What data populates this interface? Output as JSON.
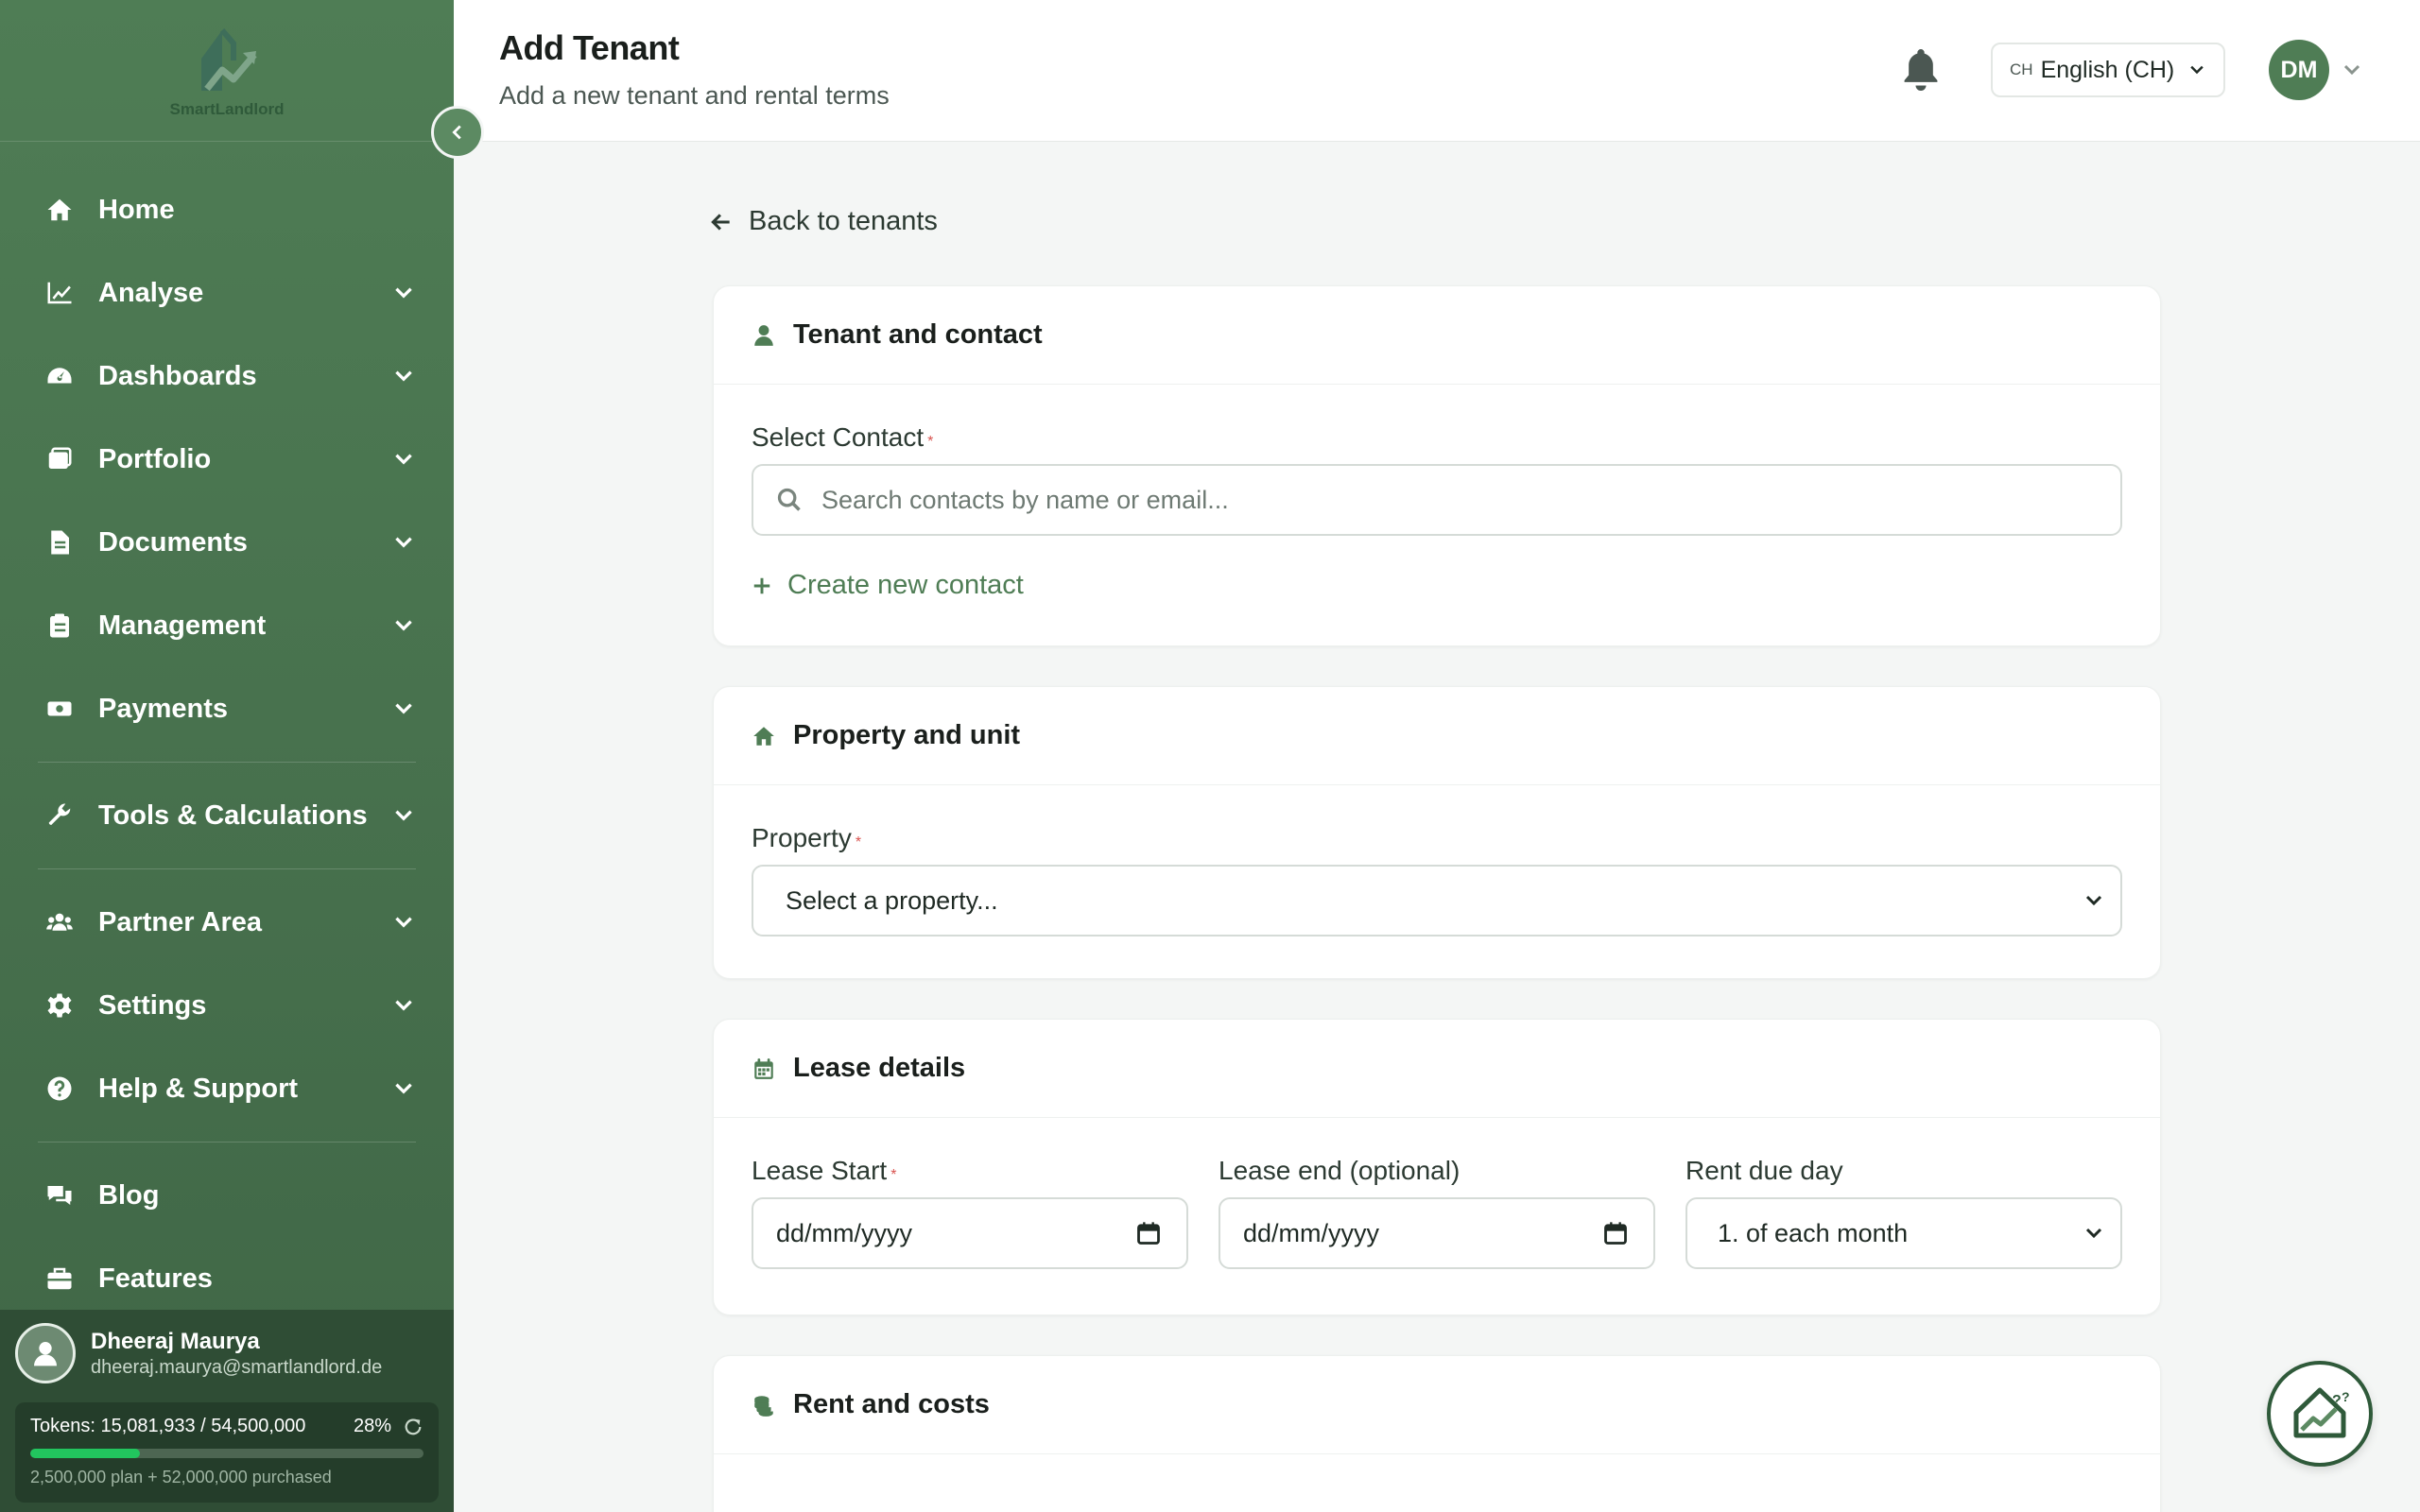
{
  "sidebar": {
    "logo_text": "SmartLandlord",
    "items": [
      {
        "label": "Home",
        "icon": "home-icon",
        "has_children": false
      },
      {
        "label": "Analyse",
        "icon": "chart-line-icon",
        "has_children": true
      },
      {
        "label": "Dashboards",
        "icon": "gauge-icon",
        "has_children": true
      },
      {
        "label": "Portfolio",
        "icon": "portfolio-icon",
        "has_children": true
      },
      {
        "label": "Documents",
        "icon": "document-icon",
        "has_children": true
      },
      {
        "label": "Management",
        "icon": "clipboard-icon",
        "has_children": true
      },
      {
        "label": "Payments",
        "icon": "money-icon",
        "has_children": true
      },
      {
        "label": "Tools & Calculations",
        "icon": "wrench-icon",
        "has_children": true
      },
      {
        "label": "Partner Area",
        "icon": "users-icon",
        "has_children": true
      },
      {
        "label": "Settings",
        "icon": "gear-icon",
        "has_children": true
      },
      {
        "label": "Help & Support",
        "icon": "question-icon",
        "has_children": true
      },
      {
        "label": "Blog",
        "icon": "comments-icon",
        "has_children": false
      },
      {
        "label": "Features",
        "icon": "briefcase-icon",
        "has_children": false
      }
    ],
    "user": {
      "name": "Dheeraj Maurya",
      "email": "dheeraj.maurya@smartlandlord.de"
    },
    "tokens": {
      "label": "Tokens: 15,081,933 / 54,500,000",
      "percent_label": "28%",
      "percent": 28,
      "note": "2,500,000 plan + 52,000,000 purchased"
    }
  },
  "header": {
    "title": "Add Tenant",
    "subtitle": "Add a new tenant and rental terms",
    "language_code": "CH",
    "language_label": "English (CH)",
    "user_initials": "DM"
  },
  "main": {
    "back_label": "Back to tenants",
    "tenant_card": {
      "title": "Tenant and contact",
      "select_contact_label": "Select Contact",
      "required_mark": "*",
      "search_placeholder": "Search contacts by name or email...",
      "create_label": "Create new contact"
    },
    "property_card": {
      "title": "Property and unit",
      "property_label": "Property",
      "required_mark": "*",
      "property_value": "Select a property..."
    },
    "lease_card": {
      "title": "Lease details",
      "lease_start_label": "Lease Start",
      "required_mark": "*",
      "lease_start_value": "dd/mm/yyyy",
      "lease_end_label": "Lease end (optional)",
      "lease_end_value": "dd/mm/yyyy",
      "rent_due_label": "Rent due day",
      "rent_due_value": "1. of each month"
    },
    "rent_card": {
      "title": "Rent and costs"
    }
  },
  "colors": {
    "brand_green": "#4f7d55",
    "sidebar_dark": "#2f4d35",
    "token_bar": "#22c55e",
    "required": "#d9534f"
  }
}
